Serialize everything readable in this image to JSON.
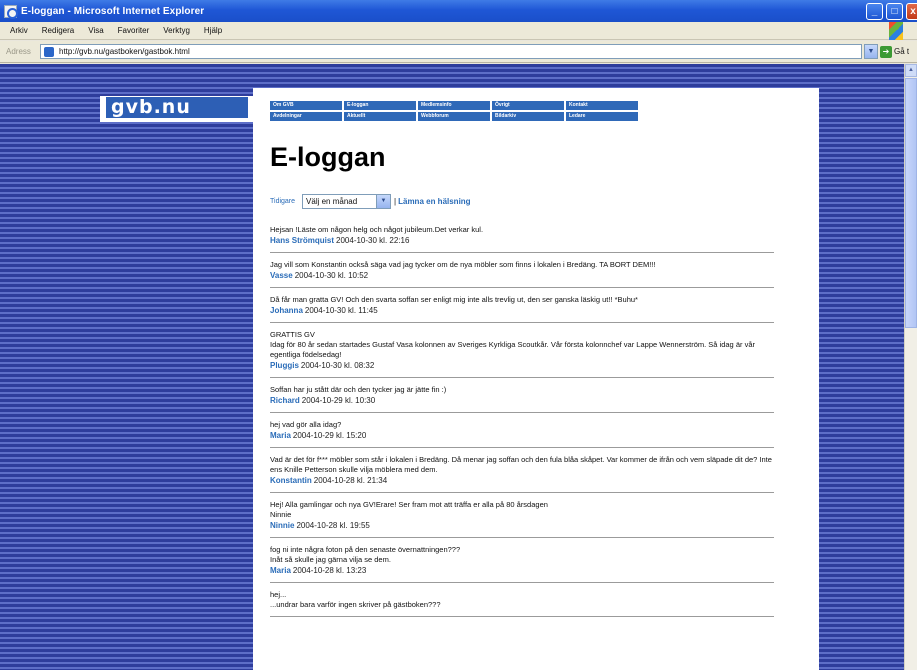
{
  "window": {
    "title": "E-loggan - Microsoft Internet Explorer"
  },
  "menu": [
    "Arkiv",
    "Redigera",
    "Visa",
    "Favoriter",
    "Verktyg",
    "Hjälp"
  ],
  "address": {
    "label": "Adress",
    "url": "http://gvb.nu/gastboken/gastbok.html",
    "go_label": "Gå t"
  },
  "site": {
    "logo": "gvb.nu",
    "nav": [
      "Om GVB",
      "E-loggan",
      "Medlemsinfo",
      "Övrigt",
      "Kontakt",
      "Avdelningar",
      "Aktuellt",
      "Webbforum",
      "Bildarkiv",
      "Ledare"
    ],
    "page_title": "E-loggan",
    "time_label": "Tidigare",
    "select_value": "Välj en månad",
    "separator": "|",
    "leave_link": "Lämna en hälsning"
  },
  "entries": [
    {
      "message": "Hejsan !Läste om någon helg och något jubileum.Det verkar kul.",
      "author": "Hans Strömquist",
      "date": "2004-10-30 kl. 22:16"
    },
    {
      "message": "Jag vill som Konstantin också säga vad jag tycker om de nya möbler som finns i lokalen i Bredäng. TA BORT DEM!!!",
      "author": "Vasse",
      "date": "2004-10-30 kl. 10:52"
    },
    {
      "message": "Då får man gratta GV! Och den svarta soffan ser enligt mig inte alls trevlig ut, den ser ganska läskig ut!! *Buhu*",
      "author": "Johanna",
      "date": "2004-10-30 kl. 11:45"
    },
    {
      "message": "GRATTIS GV\nIdag för 80 år sedan startades Gustaf Vasa kolonnen av Sveriges Kyrkliga Scoutkår. Vår första kolonnchef var Lappe Wennerström. Så idag är vår egentliga födelsedag!",
      "author": "Pluggis",
      "date": "2004-10-30 kl. 08:32"
    },
    {
      "message": "Soffan har ju stått där och den tycker jag är jätte fin :)",
      "author": "Richard",
      "date": "2004-10-29 kl. 10:30"
    },
    {
      "message": "hej vad gör alla idag?",
      "author": "Maria",
      "date": "2004-10-29 kl. 15:20"
    },
    {
      "message": "Vad är det för f*** möbler som står i lokalen i Bredäng. Då menar jag soffan och den fula blåa skåpet. Var kommer de ifrån och vem släpade dit de? Inte ens Knille Petterson skulle vilja möblera med dem.",
      "author": "Konstantin",
      "date": "2004-10-28 kl. 21:34"
    },
    {
      "message": "Hej! Alla gamlingar och nya GV!Erare! Ser fram mot att träffa er alla på 80 årsdagen\nNinnie",
      "author": "Ninnie",
      "date": "2004-10-28 kl. 19:55"
    },
    {
      "message": "fog ni inte några foton på den senaste övernattningen???\nInåt så skulle jag gärna vilja se dem.",
      "author": "Maria",
      "date": "2004-10-28 kl. 13:23"
    },
    {
      "message": "hej...\n...undrar bara varför ingen skriver på gästboken???",
      "author": "",
      "date": ""
    }
  ]
}
